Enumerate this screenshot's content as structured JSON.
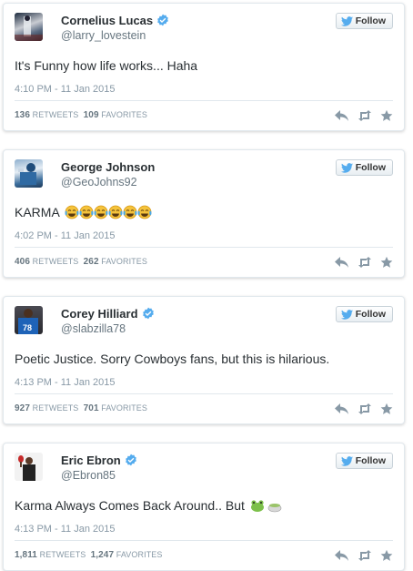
{
  "follow_label": "Follow",
  "retweets_label": "RETWEETS",
  "favorites_label": "FAVORITES",
  "icons": {
    "verified": "verified-badge-icon",
    "follow": "twitter-bird-icon",
    "reply": "reply-icon",
    "retweet": "retweet-icon",
    "favorite": "star-icon"
  },
  "colors": {
    "verified": "#55acee",
    "action": "#8899a6",
    "bird": "#55acee"
  },
  "tweets": [
    {
      "name": "Cornelius Lucas",
      "handle": "@larry_lovestein",
      "text": "It's Funny how life works... Haha",
      "time": "4:10 PM - 11 Jan 2015",
      "retweets": "136",
      "favorites": "109",
      "verified": true
    },
    {
      "name": "George Johnson",
      "handle": "@GeoJohns92",
      "text": "KARMA",
      "time": "4:02 PM - 11 Jan 2015",
      "retweets": "406",
      "favorites": "262",
      "verified": false
    },
    {
      "name": "Corey Hilliard",
      "handle": "@slabzilla78",
      "text": "Poetic Justice.  Sorry Cowboys fans, but this is hilarious.",
      "time": "4:13 PM - 11 Jan 2015",
      "retweets": "927",
      "favorites": "701",
      "verified": true
    },
    {
      "name": "Eric Ebron",
      "handle": "@Ebron85",
      "text": "Karma Always Comes Back Around.. But",
      "time": "4:13 PM - 11 Jan 2015",
      "retweets": "1,811",
      "favorites": "1,247",
      "verified": true
    }
  ]
}
